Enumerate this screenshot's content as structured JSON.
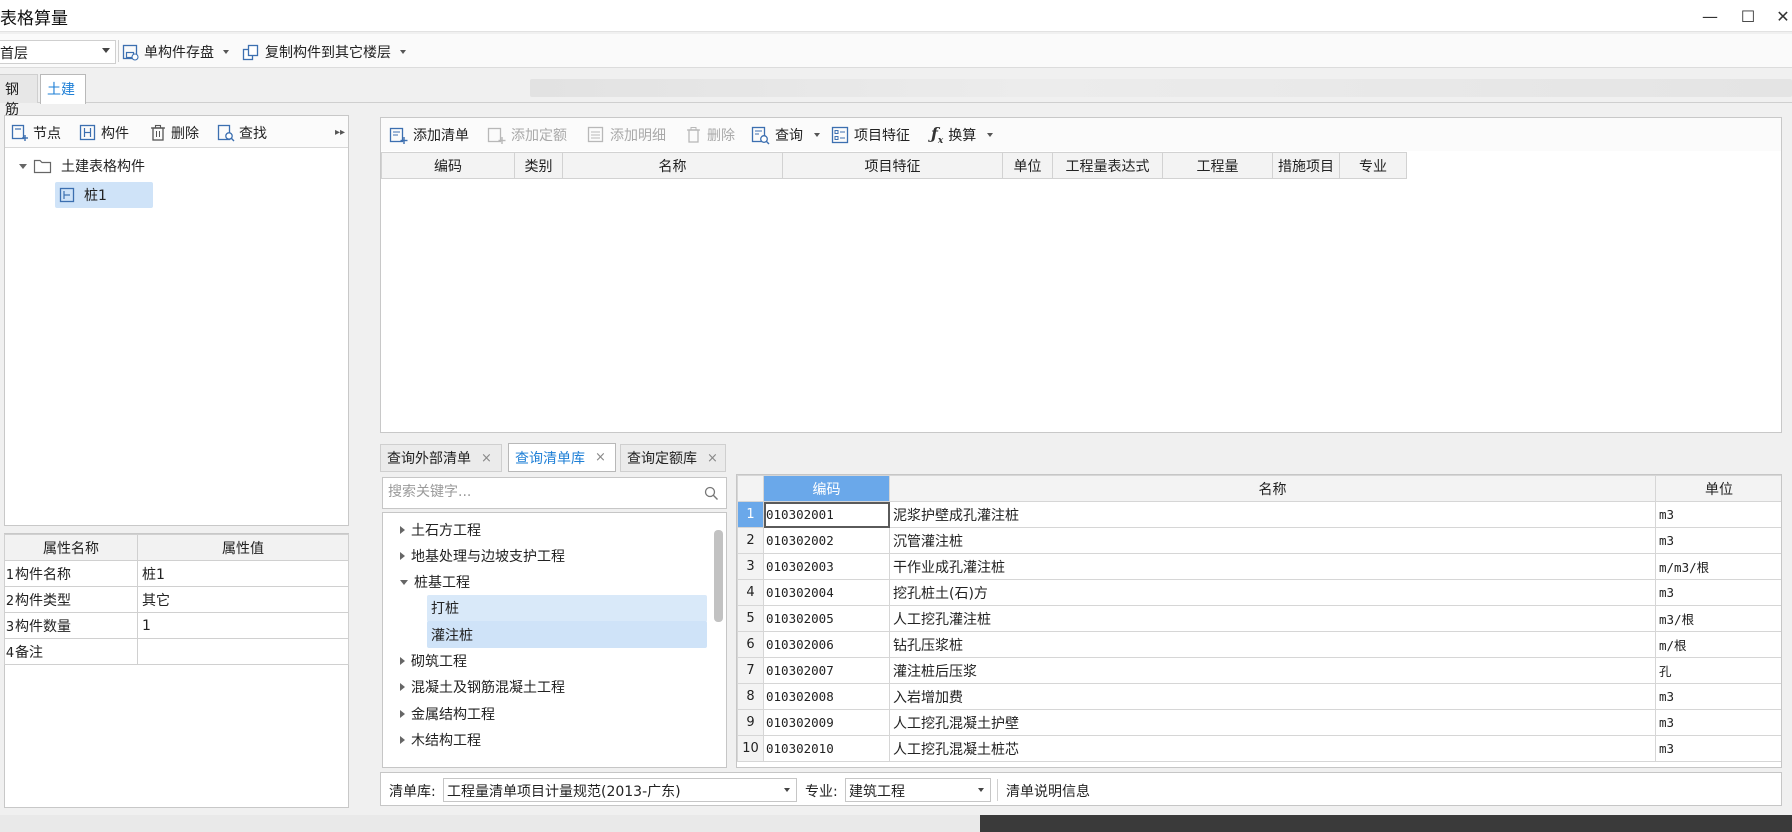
{
  "window": {
    "title": "表格算量",
    "minimize": "—",
    "maximize": "☐",
    "close": "✕"
  },
  "toolbar": {
    "floor": "首层",
    "save_component": "单构件存盘",
    "copy_to_floor": "复制构件到其它楼层"
  },
  "main_tabs": [
    "钢筋",
    "土建"
  ],
  "left_toolbar": {
    "node": "节点",
    "component": "构件",
    "delete": "删除",
    "find": "查找"
  },
  "component_tree": {
    "root": "土建表格构件",
    "child": "桩1"
  },
  "properties": {
    "headers": [
      "属性名称",
      "属性值"
    ],
    "rows": [
      {
        "no": "1",
        "name": "构件名称",
        "value": "桩1"
      },
      {
        "no": "2",
        "name": "构件类型",
        "value": "其它"
      },
      {
        "no": "3",
        "name": "构件数量",
        "value": "1"
      },
      {
        "no": "4",
        "name": "备注",
        "value": ""
      }
    ]
  },
  "list_toolbar": {
    "add_list": "添加清单",
    "add_quota": "添加定额",
    "add_detail": "添加明细",
    "delete": "删除",
    "query": "查询",
    "features": "项目特征",
    "convert": "换算"
  },
  "list_grid_headers": [
    "编码",
    "类别",
    "名称",
    "项目特征",
    "单位",
    "工程量表达式",
    "工程量",
    "措施项目",
    "专业"
  ],
  "query_tabs": [
    "查询外部清单",
    "查询清单库",
    "查询定额库"
  ],
  "search": {
    "placeholder": "搜索关键字..."
  },
  "category_tree": [
    {
      "label": "土石方工程",
      "state": "collapsed"
    },
    {
      "label": "地基处理与边坡支护工程",
      "state": "collapsed"
    },
    {
      "label": "桩基工程",
      "state": "expanded"
    },
    {
      "label": "打桩",
      "state": "child"
    },
    {
      "label": "灌注桩",
      "state": "child-selected"
    },
    {
      "label": "砌筑工程",
      "state": "collapsed"
    },
    {
      "label": "混凝土及钢筋混凝土工程",
      "state": "collapsed"
    },
    {
      "label": "金属结构工程",
      "state": "collapsed"
    },
    {
      "label": "木结构工程",
      "state": "collapsed"
    }
  ],
  "result_grid": {
    "headers": [
      "编码",
      "名称",
      "单位"
    ],
    "rows": [
      {
        "no": "1",
        "code": "010302001",
        "name": "泥浆护壁成孔灌注桩",
        "unit": "m3"
      },
      {
        "no": "2",
        "code": "010302002",
        "name": "沉管灌注桩",
        "unit": "m3"
      },
      {
        "no": "3",
        "code": "010302003",
        "name": "干作业成孔灌注桩",
        "unit": "m/m3/根"
      },
      {
        "no": "4",
        "code": "010302004",
        "name": "挖孔桩土(石)方",
        "unit": "m3"
      },
      {
        "no": "5",
        "code": "010302005",
        "name": "人工挖孔灌注桩",
        "unit": "m3/根"
      },
      {
        "no": "6",
        "code": "010302006",
        "name": "钻孔压浆桩",
        "unit": "m/根"
      },
      {
        "no": "7",
        "code": "010302007",
        "name": "灌注桩后压浆",
        "unit": "孔"
      },
      {
        "no": "8",
        "code": "010302008",
        "name": "入岩增加费",
        "unit": "m3"
      },
      {
        "no": "9",
        "code": "010302009",
        "name": "人工挖孔混凝土护壁",
        "unit": "m3"
      },
      {
        "no": "10",
        "code": "010302010",
        "name": "人工挖孔混凝土桩芯",
        "unit": "m3"
      }
    ]
  },
  "filter": {
    "library_label": "清单库:",
    "library_value": "工程量清单项目计量规范(2013-广东)",
    "major_label": "专业:",
    "major_value": "建筑工程",
    "info_link": "清单说明信息"
  },
  "colors": {
    "accent": "#1e7fd6",
    "header_highlight": "#6aa8ea",
    "selection": "#cfe3f8"
  }
}
